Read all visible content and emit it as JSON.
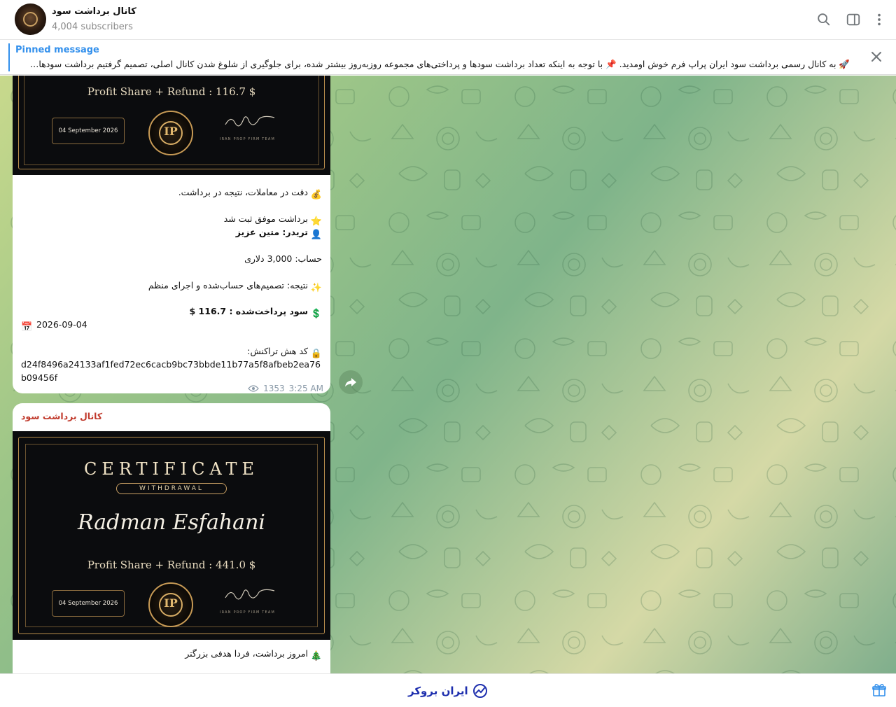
{
  "header": {
    "title": "کانال برداشت سود",
    "subscribers": "4,004 subscribers"
  },
  "pinned": {
    "label": "Pinned message",
    "text": "🚀 به کانال رسمی برداشت سود ایران پراپ فرم خوش اومدید. 📌 با توجه به اینکه تعداد برداشت سودها و پرداختی‌های مجموعه روزبه‌روز بیشتر شده، برای جلوگیری از شلوغ شدن کانال اصلی، تصمیم گرفتیم برداشت سودهای مج..."
  },
  "message1": {
    "certificate": {
      "profit_line": "Profit Share + Refund : 116.7 $",
      "date": "04 September 2026",
      "team": "IRAN PROP FIRM TEAM",
      "logo_letters": "IP"
    },
    "lines": {
      "l1": "دقت در معاملات، نتیجه در برداشت.",
      "l2": "برداشت موفق ثبت شد",
      "l3": "تریدر: متین عزیز",
      "l4": "حساب: 3,000 دلاری",
      "l5": "نتیجه: تصمیم‌های حساب‌شده و اجرای منظم",
      "l6": "سود پرداخت‌شده : 116.7 $",
      "l7_date": "2026-09-04",
      "l8": "کد هش تراکنش:",
      "hash": "d24f8496a24133af1fed72ec6cacb9bc73bbde11b77a5f8afbeb2ea76b09456f"
    },
    "emojis": {
      "e1": "💰",
      "e2": "⭐",
      "e3": "👤",
      "e5": "✨",
      "e6": "💲",
      "e7": "📅",
      "e8": "🔒"
    },
    "views": "1353",
    "time": "3:25 AM"
  },
  "message2": {
    "sender": "کانال برداشت سود",
    "certificate": {
      "title": "CERTIFICATE",
      "subtitle": "WITHDRAWAL",
      "name": "Radman Esfahani",
      "profit_line": "Profit Share + Refund : 441.0 $",
      "date": "04 September 2026",
      "team": "IRAN PROP FIRM TEAM",
      "logo_letters": "IP"
    },
    "lines": {
      "l1": "امروز برداشت، فردا هدفی بزرگتر"
    },
    "emojis": {
      "e1": "🎄",
      "e2": "⭐"
    }
  },
  "footer": {
    "brand": "ایران بروکر"
  },
  "colors": {
    "accent": "#3390ec",
    "sender": "#c0392b",
    "brand": "#1e2fae",
    "gold": "#c9a063"
  },
  "icons": {
    "search": "search-icon",
    "sidebar": "sidebar-toggle-icon",
    "more": "more-vertical-icon",
    "close": "close-icon",
    "forward": "forward-icon",
    "eye": "eye-icon",
    "gift": "gift-icon"
  }
}
